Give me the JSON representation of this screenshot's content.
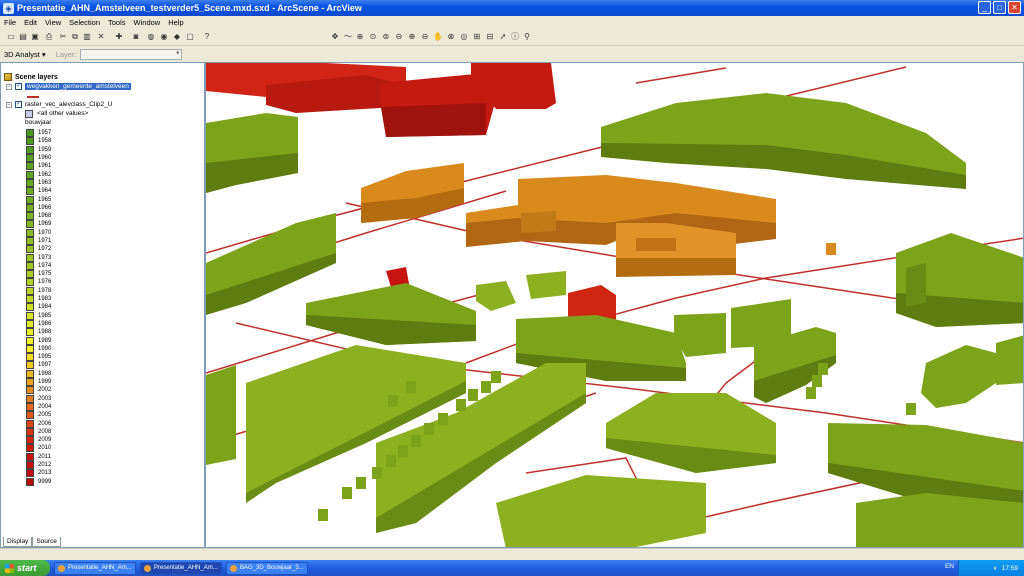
{
  "window": {
    "title": "Presentatie_AHN_Amstelveen_testverder5_Scene.mxd.sxd - ArcScene - ArcView",
    "minimize": "_",
    "maximize": "□",
    "close": "✕"
  },
  "menu": [
    "File",
    "Edit",
    "View",
    "Selection",
    "Tools",
    "Window",
    "Help"
  ],
  "toolbar2": {
    "analyst_label": "3D Analyst ▾",
    "layer_label": "Layer:",
    "layer_value": ""
  },
  "toc": {
    "root_label": "Scene layers",
    "layers": [
      {
        "name": "wegvakken_gemeente_amstelveen",
        "checked": "✓",
        "selected": true
      },
      {
        "name": "raster_vec_alevclass_Clip2_U",
        "checked": "✓",
        "selected": false
      }
    ],
    "other_values": "<all other values>",
    "field_name": "bouwjaar",
    "legend": [
      {
        "label": "1957",
        "color": "#4a9a1e"
      },
      {
        "label": "1958",
        "color": "#4e9c1e"
      },
      {
        "label": "1959",
        "color": "#539e1e"
      },
      {
        "label": "1960",
        "color": "#58a01f"
      },
      {
        "label": "1961",
        "color": "#5da21f"
      },
      {
        "label": "1962",
        "color": "#62a520"
      },
      {
        "label": "1963",
        "color": "#67a720"
      },
      {
        "label": "1964",
        "color": "#6daa20"
      },
      {
        "label": "1965",
        "color": "#72ad21"
      },
      {
        "label": "1966",
        "color": "#78b021"
      },
      {
        "label": "1968",
        "color": "#7eb322"
      },
      {
        "label": "1969",
        "color": "#84b622"
      },
      {
        "label": "1970",
        "color": "#8aba23"
      },
      {
        "label": "1971",
        "color": "#90bd23"
      },
      {
        "label": "1972",
        "color": "#97c124"
      },
      {
        "label": "1973",
        "color": "#9dc524"
      },
      {
        "label": "1974",
        "color": "#a4c925"
      },
      {
        "label": "1975",
        "color": "#abcd25"
      },
      {
        "label": "1976",
        "color": "#b2d126"
      },
      {
        "label": "1978",
        "color": "#bad526"
      },
      {
        "label": "1983",
        "color": "#c2da27"
      },
      {
        "label": "1984",
        "color": "#cade27"
      },
      {
        "label": "1985",
        "color": "#d3e328"
      },
      {
        "label": "1986",
        "color": "#dce828"
      },
      {
        "label": "1988",
        "color": "#e5ed29"
      },
      {
        "label": "1989",
        "color": "#eef129"
      },
      {
        "label": "1990",
        "color": "#f4ee28"
      },
      {
        "label": "1995",
        "color": "#f2dc26"
      },
      {
        "label": "1997",
        "color": "#f0c924"
      },
      {
        "label": "1998",
        "color": "#edb622"
      },
      {
        "label": "1999",
        "color": "#eaa320"
      },
      {
        "label": "2002",
        "color": "#e78f1e"
      },
      {
        "label": "2003",
        "color": "#e47c1c"
      },
      {
        "label": "2004",
        "color": "#e0691a"
      },
      {
        "label": "2005",
        "color": "#dc5618"
      },
      {
        "label": "2006",
        "color": "#d84416"
      },
      {
        "label": "2008",
        "color": "#d43414"
      },
      {
        "label": "2009",
        "color": "#d02512"
      },
      {
        "label": "2010",
        "color": "#cc1a11"
      },
      {
        "label": "2011",
        "color": "#c81410"
      },
      {
        "label": "2012",
        "color": "#c4100f"
      },
      {
        "label": "2013",
        "color": "#bf0e0e"
      },
      {
        "label": "9999",
        "color": "#b40c0c"
      }
    ],
    "tabs": [
      "Display",
      "Source"
    ]
  },
  "colors": {
    "building_green": "#7da31a",
    "building_green_dark": "#5e7c10",
    "building_orange": "#d98a1c",
    "building_red": "#c41a10",
    "road_red": "#c0302a"
  },
  "taskbar": {
    "start": "start",
    "tasks": [
      "Presentatie_AHN_Am...",
      "Presentatie_AHN_Am...",
      "BAG_3D_Bouwjaar_3..."
    ],
    "lang": "EN",
    "clock": "17:59"
  }
}
